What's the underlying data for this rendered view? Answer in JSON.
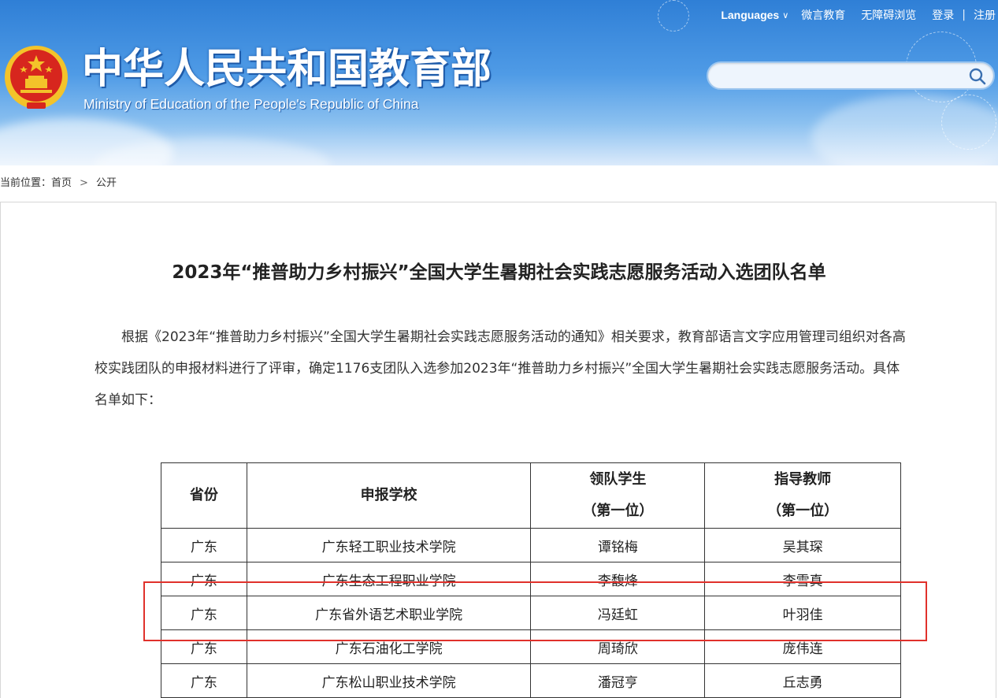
{
  "header": {
    "site_title_cn": "中华人民共和国教育部",
    "site_title_en": "Ministry of Education of the People's Republic of China",
    "topnav": {
      "languages": "Languages",
      "weibo": "微言教育",
      "accessibility": "无障碍浏览",
      "login": "登录",
      "separator": "|",
      "register": "注册"
    },
    "search": {
      "placeholder": "",
      "value": ""
    },
    "colors": {
      "header_top": "#2f7fd6",
      "header_bottom": "#dbeafb",
      "emblem_red": "#d7261e",
      "emblem_gold": "#f3c32a"
    }
  },
  "breadcrumb": {
    "label": "当前位置：",
    "home": "首页",
    "arrow": ">",
    "current": "公开"
  },
  "article": {
    "title": "2023年“推普助力乡村振兴”全国大学生暑期社会实践志愿服务活动入选团队名单",
    "body": "根据《2023年“推普助力乡村振兴”全国大学生暑期社会实践志愿服务活动的通知》相关要求，教育部语言文字应用管理司组织对各高校实践团队的申报材料进行了评审，确定1176支团队入选参加2023年“推普助力乡村振兴”全国大学生暑期社会实践志愿服务活动。具体名单如下："
  },
  "table": {
    "headers": {
      "province": "省份",
      "school": "申报学校",
      "leader_line1": "领队学生",
      "leader_line2": "（第一位）",
      "teacher_line1": "指导教师",
      "teacher_line2": "（第一位）"
    },
    "rows": [
      {
        "province": "广东",
        "school": "广东轻工职业技术学院",
        "leader": "谭铭梅",
        "teacher": "吴其琛"
      },
      {
        "province": "广东",
        "school": "广东生态工程职业学院",
        "leader": "李馥烽",
        "teacher": "李雪真"
      },
      {
        "province": "广东",
        "school": "广东省外语艺术职业学院",
        "leader": "冯廷虹",
        "teacher": "叶羽佳"
      },
      {
        "province": "广东",
        "school": "广东石油化工学院",
        "leader": "周琦欣",
        "teacher": "庞伟连"
      },
      {
        "province": "广东",
        "school": "广东松山职业技术学院",
        "leader": "潘冠亨",
        "teacher": "丘志勇"
      }
    ],
    "highlight_color": "#e0312b"
  }
}
